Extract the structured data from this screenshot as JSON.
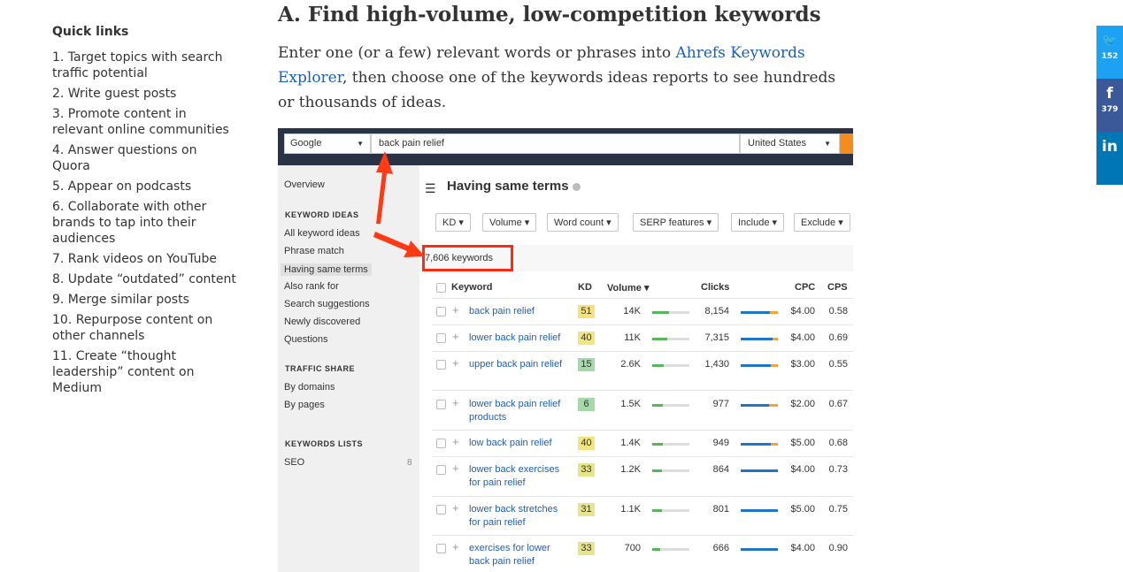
{
  "quick_links": {
    "title": "Quick links",
    "items": [
      "1. Target topics with search traffic potential",
      "2. Write guest posts",
      "3. Promote content in relevant online communities",
      "4. Answer questions on Quora",
      "5. Appear on podcasts",
      "6. Collaborate with other brands to tap into their audiences",
      "7. Rank videos on YouTube",
      "8. Update “outdated” content",
      "9. Merge similar posts",
      "10. Repurpose content on other channels",
      "11. Create “thought leadership” content on Medium"
    ]
  },
  "article": {
    "heading": "A. Find high-volume, low-competition keywords",
    "para_before": "Enter one (or a few) relevant words or phrases into ",
    "link_text": "Ahrefs Keywords Explorer",
    "para_after": ", then choose one of the keywords ideas reports to see hundreds or thousands of ideas."
  },
  "screenshot": {
    "search_engine": "Google",
    "query": "back pain relief",
    "country": "United States",
    "sidebar": {
      "overview": "Overview",
      "section_keyword_ideas": "KEYWORD IDEAS",
      "keyword_ideas": [
        "All keyword ideas",
        "Phrase match",
        "Having same terms",
        "Also rank for",
        "Search suggestions",
        "Newly discovered",
        "Questions"
      ],
      "section_traffic_share": "TRAFFIC SHARE",
      "traffic_share": [
        "By domains",
        "By pages"
      ],
      "section_keyword_lists": "KEYWORDS LISTS",
      "list_name": "SEO",
      "list_count": "8"
    },
    "main": {
      "title": "Having same terms",
      "filters": [
        "KD ▾",
        "Volume ▾",
        "Word count ▾",
        "SERP features ▾",
        "Include ▾",
        "Exclude ▾"
      ],
      "keyword_count": "7,606 keywords",
      "columns": {
        "keyword": "Keyword",
        "kd": "KD",
        "volume": "Volume ▾",
        "clicks": "Clicks",
        "cpc": "CPC",
        "cps": "CPS"
      },
      "rows": [
        {
          "keyword": "back pain relief",
          "kd": "51",
          "volume": "14K",
          "clicks": "8,154",
          "cpc": "$4.00",
          "cps": "0.58",
          "kd_color": "#f7e27a",
          "vol_fill": 0.45,
          "org_frac": 0.22
        },
        {
          "keyword": "lower back pain relief",
          "kd": "40",
          "volume": "11K",
          "clicks": "7,315",
          "cpc": "$4.00",
          "cps": "0.69",
          "kd_color": "#f0e57e",
          "vol_fill": 0.4,
          "org_frac": 0.15
        },
        {
          "keyword": "upper back pain relief",
          "kd": "15",
          "volume": "2.6K",
          "clicks": "1,430",
          "cpc": "$3.00",
          "cps": "0.55",
          "kd_color": "#a6d9a8",
          "vol_fill": 0.3,
          "org_frac": 0.2
        },
        {
          "keyword": "lower back pain relief products",
          "kd": "6",
          "volume": "1.5K",
          "clicks": "977",
          "cpc": "$2.00",
          "cps": "0.67",
          "kd_color": "#a6d9a8",
          "vol_fill": 0.28,
          "org_frac": 0.25
        },
        {
          "keyword": "low back pain relief",
          "kd": "40",
          "volume": "1.4K",
          "clicks": "949",
          "cpc": "$5.00",
          "cps": "0.68",
          "kd_color": "#f0e57e",
          "vol_fill": 0.28,
          "org_frac": 0.18
        },
        {
          "keyword": "lower back exercises for pain relief",
          "kd": "33",
          "volume": "1.2K",
          "clicks": "864",
          "cpc": "$4.00",
          "cps": "0.73",
          "kd_color": "#e7e58a",
          "vol_fill": 0.27,
          "org_frac": 0.0
        },
        {
          "keyword": "lower back stretches for pain relief",
          "kd": "31",
          "volume": "1.1K",
          "clicks": "801",
          "cpc": "$5.00",
          "cps": "0.75",
          "kd_color": "#e7e58a",
          "vol_fill": 0.26,
          "org_frac": 0.0
        },
        {
          "keyword": "exercises for lower back pain relief",
          "kd": "33",
          "volume": "700",
          "clicks": "666",
          "cpc": "$4.00",
          "cps": "0.90",
          "kd_color": "#e7e58a",
          "vol_fill": 0.22,
          "org_frac": 0.0
        }
      ]
    }
  },
  "share": [
    {
      "icon": "twitter-icon",
      "glyph": "🐦",
      "count": "152",
      "color": "#1da1f2"
    },
    {
      "icon": "facebook-icon",
      "glyph": "f",
      "count": "379",
      "color": "#3b5998"
    },
    {
      "icon": "linkedin-icon",
      "glyph": "in",
      "count": "",
      "color": "#0077b5"
    }
  ]
}
